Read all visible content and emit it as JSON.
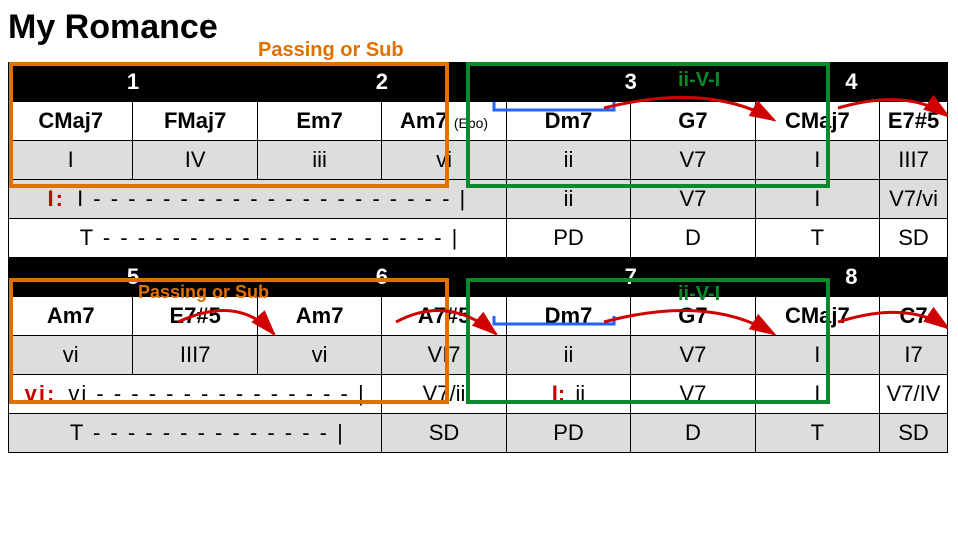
{
  "title": "My Romance",
  "labels": {
    "passing1": "Passing or Sub",
    "passing2": "Passing or Sub",
    "iiVI1": "ii-V-I",
    "iiVI2": "ii-V-I"
  },
  "bars": {
    "row1": {
      "b1": "1",
      "b2": "2",
      "b3": "3",
      "b4": "4"
    },
    "row2": {
      "b5": "5",
      "b6": "6",
      "b7": "7",
      "b8": "8"
    }
  },
  "chords": {
    "m1a": "CMaj7",
    "m1b": "FMaj7",
    "m2a": "Em7",
    "m2b": "Am7",
    "m2p": "(Ebo)",
    "m3a": "Dm7",
    "m3b": "G7",
    "m4a": "CMaj7",
    "m4x": "E7#5",
    "m5a": "Am7",
    "m5b": "E7#5",
    "m6a": "Am7",
    "m6b": "A7#5",
    "m7a": "Dm7",
    "m7b": "G7",
    "m8a": "CMaj7",
    "m8x": "C7"
  },
  "roman": {
    "r1a": "I",
    "r1b": "IV",
    "r2a": "iii",
    "r2b": "vi",
    "r3a": "ii",
    "r3b": "V7",
    "r4a": "I",
    "r4x": "III7",
    "r5a": "vi",
    "r5b": "III7",
    "r6a": "vi",
    "r6b": "VI7",
    "r7a": "ii",
    "r7b": "V7",
    "r8a": "I",
    "r8x": "I7"
  },
  "analysis1": {
    "key": "I:",
    "prolong": "I - - - - - - - - - - - - - - - - - - - - - |",
    "c3a": "ii",
    "c3b": "V7",
    "c4a": "I",
    "c4b": "V7/vi",
    "func12": "T - - - - - - - - - - - - - - - - - - - - |",
    "f3a": "PD",
    "f3b": "D",
    "f4a": "T",
    "f4b": "SD"
  },
  "analysis2": {
    "key5": "vi:",
    "prolong5": "vi - - - - - - - - - - - - - - - |",
    "c6b": "V7/ii",
    "key7": "I:",
    "c7a": "ii",
    "c7b": "V7",
    "c8a": "I",
    "c8b": "V7/IV",
    "func56": "T - - - - - - - - - - - - - - |",
    "f6b": "SD",
    "f7a": "PD",
    "f7b": "D",
    "f8a": "T",
    "f8b": "SD"
  }
}
